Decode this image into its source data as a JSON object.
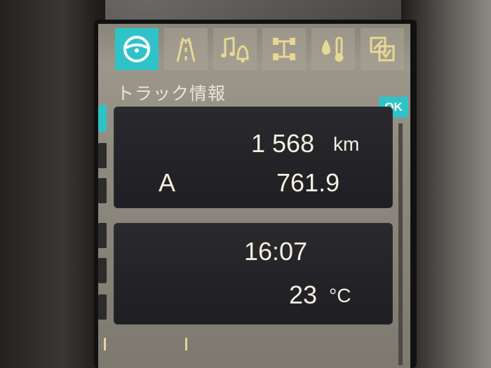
{
  "screen": {
    "title": "トラック情報",
    "ok_badge": "OK"
  },
  "tabs": [
    {
      "icon": "steering-wheel-icon",
      "active": true
    },
    {
      "icon": "road-lane-icon",
      "active": false
    },
    {
      "icon": "music-bell-icon",
      "active": false
    },
    {
      "icon": "truck-axle-icon",
      "active": false
    },
    {
      "icon": "temperature-drop-icon",
      "active": false
    },
    {
      "icon": "settings-check-icon",
      "active": false
    }
  ],
  "trip_card": {
    "odometer_value": "1 568",
    "odometer_unit": "km",
    "trip_label": "A",
    "trip_value": "761.9"
  },
  "info_card": {
    "time": "16:07",
    "temperature_value": "23",
    "temperature_unit": "°C"
  },
  "colors": {
    "accent": "#2fc3c7",
    "text": "#f4efe0",
    "card_bg": "#1f1f23"
  }
}
